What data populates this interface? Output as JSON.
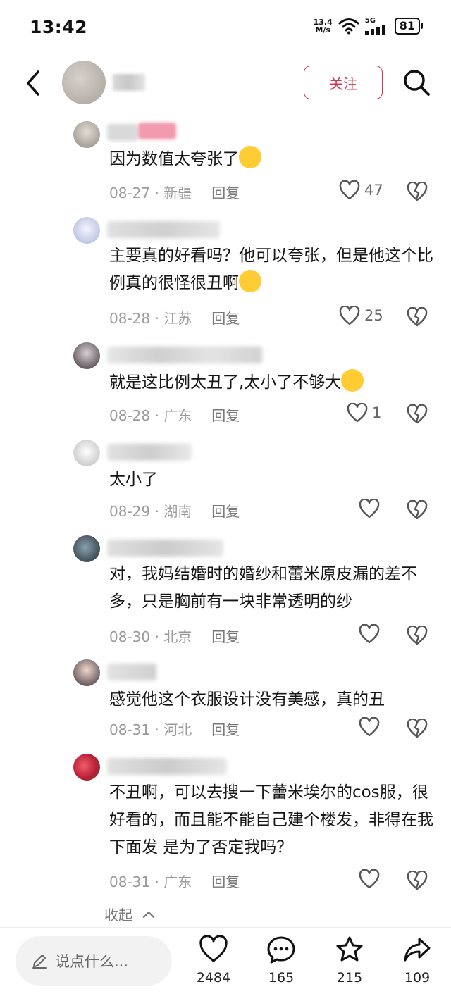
{
  "status_bar": {
    "time": "13:42",
    "speed_value": "13.4",
    "speed_unit": "M/s",
    "network": "5G",
    "battery": "81"
  },
  "header": {
    "follow_label": "关注"
  },
  "comments": [
    {
      "text": "因为数值太夸张了",
      "date": "08-27",
      "location": "新疆",
      "reply_label": "回复",
      "likes": "47"
    },
    {
      "text": "主要真的好看吗？他可以夸张，但是他这个比例真的很怪很丑啊",
      "date": "08-28",
      "location": "江苏",
      "reply_label": "回复",
      "likes": "25"
    },
    {
      "text": "就是这比例太丑了,太小了不够大",
      "date": "08-28",
      "location": "广东",
      "reply_label": "回复",
      "likes": "1"
    },
    {
      "text": "太小了",
      "date": "08-29",
      "location": "湖南",
      "reply_label": "回复",
      "likes": ""
    },
    {
      "text": "对，我妈结婚时的婚纱和蕾米原皮漏的差不多，只是胸前有一块非常透明的纱",
      "date": "08-30",
      "location": "北京",
      "reply_label": "回复",
      "likes": ""
    },
    {
      "text": "感觉他这个衣服设计没有美感，真的丑",
      "date": "08-31",
      "location": "河北",
      "reply_label": "回复",
      "likes": ""
    },
    {
      "text": "不丑啊，可以去搜一下蕾米埃尔的cos服，很好看的，而且能不能自己建个楼发，非得在我下面发 是为了否定我吗？",
      "date": "08-31",
      "location": "广东",
      "reply_label": "回复",
      "likes": ""
    }
  ],
  "meta_separator": " · ",
  "collapse_label": "收起",
  "bottom_bar": {
    "input_placeholder": "说点什么...",
    "likes": "2484",
    "comments": "165",
    "favorites": "215",
    "shares": "109"
  },
  "colors": {
    "accent": "#d6364d",
    "meta_text": "#9a9a9a"
  }
}
